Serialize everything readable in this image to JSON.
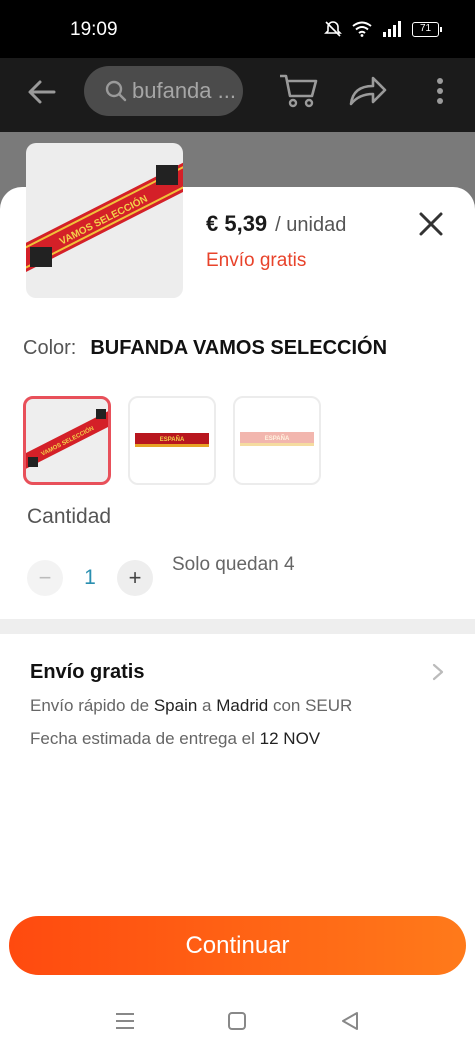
{
  "status_bar": {
    "time": "19:09",
    "battery": "71"
  },
  "header": {
    "search_text": "bufanda ..."
  },
  "product": {
    "price": "€ 5,39",
    "unit": "/ unidad",
    "shipping_tag": "Envío gratis",
    "thumb_text": "VAMOS SELECCIÓN"
  },
  "color": {
    "label": "Color:",
    "value": "BUFANDA VAMOS SELECCIÓN"
  },
  "swatches": [
    {
      "text": "VAMOS SELECCIÓN",
      "selected": true
    },
    {
      "text": "ESPAÑA",
      "selected": false
    },
    {
      "text": "ESPAÑA",
      "selected": false
    }
  ],
  "quantity": {
    "label": "Cantidad",
    "value": "1",
    "minus": "−",
    "plus": "+",
    "stock": "Solo quedan 4"
  },
  "shipping": {
    "title": "Envío gratis",
    "line1_prefix": "Envío rápido de",
    "origin": "Spain",
    "line1_mid": "a",
    "destination": "Madrid",
    "line1_suffix": "con SEUR",
    "line2_prefix": "Fecha estimada de entrega el",
    "date": "12 NOV"
  },
  "cta": {
    "label": "Continuar"
  },
  "colors": {
    "accent": "#ff4a0f",
    "price_red": "#e8432b",
    "selected_border": "#e8505a",
    "qty_blue": "#2a8fb0"
  }
}
